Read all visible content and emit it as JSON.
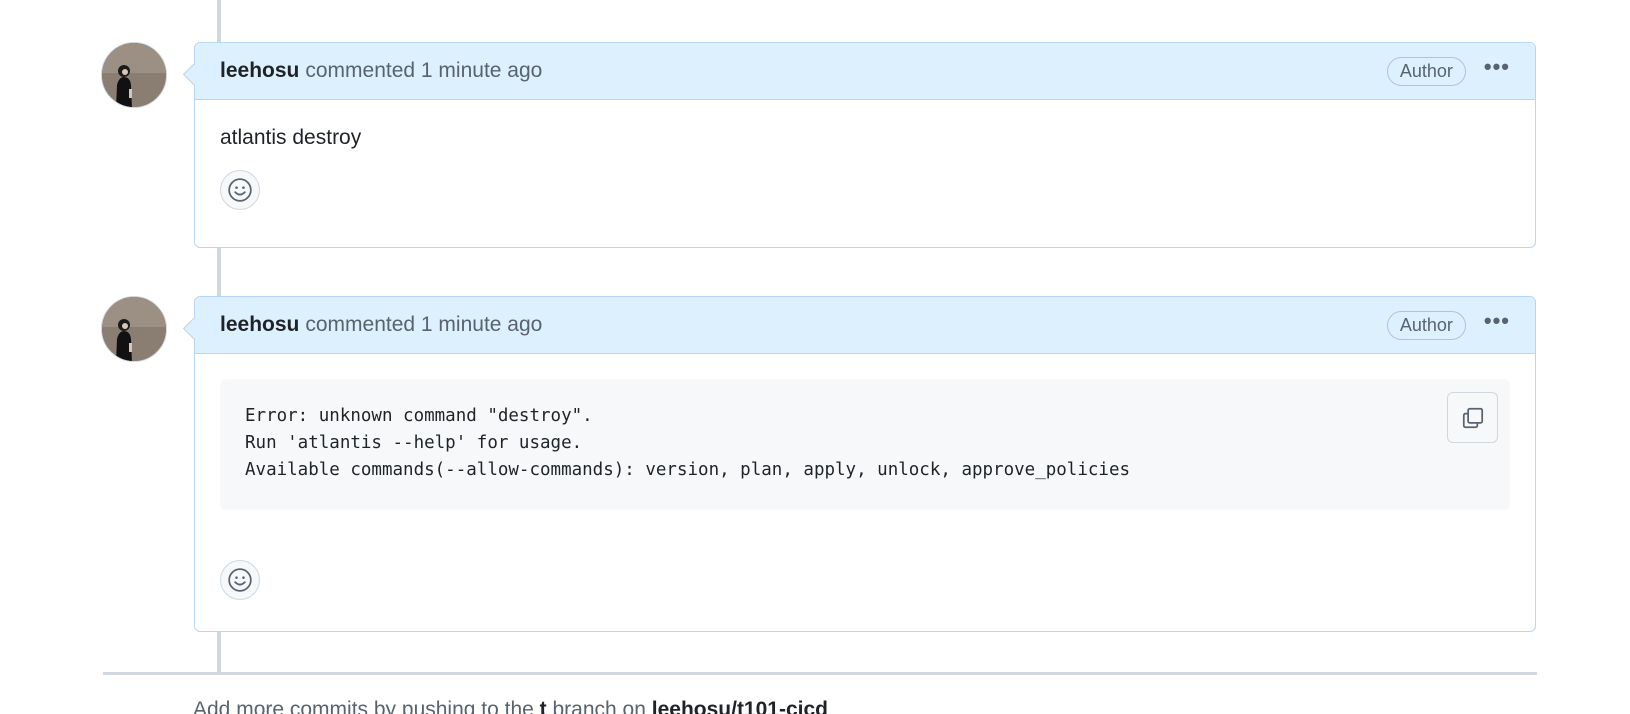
{
  "comments": [
    {
      "author": "leehosu",
      "action": "commented 1 minute ago",
      "badge": "Author",
      "body_text": "atlantis destroy"
    },
    {
      "author": "leehosu",
      "action": "commented 1 minute ago",
      "badge": "Author",
      "code_lines": [
        "Error: unknown command \"destroy\".",
        "Run 'atlantis --help' for usage.",
        "Available commands(--allow-commands): version, plan, apply, unlock, approve_policies"
      ]
    }
  ],
  "footer": {
    "prefix": "Add more commits by pushing to the ",
    "branch_label_a": "t",
    "middle": " branch on ",
    "repo": "leehosu/t101-cicd"
  },
  "colors": {
    "header_bg": "#ddf0fe",
    "header_border": "#b6d7f3",
    "code_bg": "#f6f8fa",
    "muted_text": "#59636e"
  },
  "icons": {
    "reaction": "smiley-icon",
    "copy": "copy-icon",
    "menu": "kebab-horizontal-icon"
  }
}
